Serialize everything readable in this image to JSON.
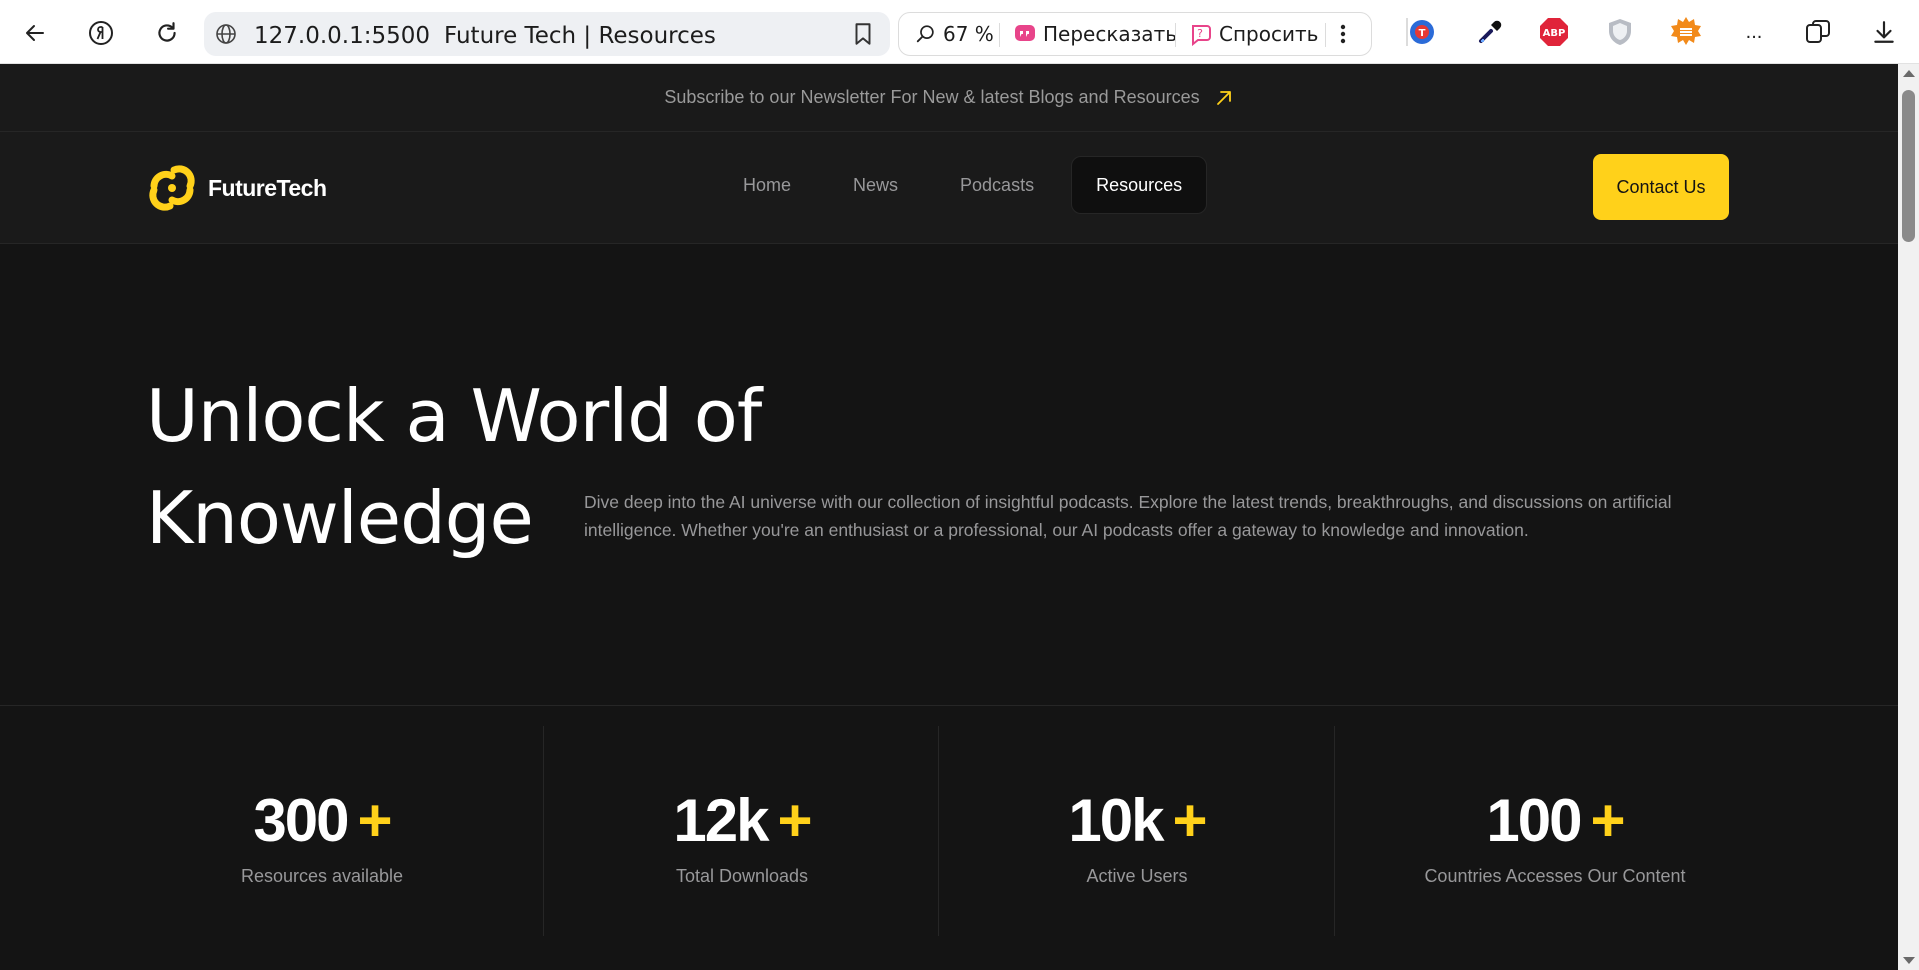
{
  "browser": {
    "url": "127.0.0.1:5500",
    "page_title": "Future Tech | Resources",
    "zoom": "67 %",
    "retell_label": "Пересказать",
    "ask_label": "Спросить",
    "more_label": "...",
    "abp_label": "ABP"
  },
  "newsletter": {
    "text": "Subscribe to our Newsletter For New & latest Blogs and Resources"
  },
  "header": {
    "logo_text": "FutureTech",
    "nav": [
      {
        "label": "Home"
      },
      {
        "label": "News"
      },
      {
        "label": "Podcasts"
      },
      {
        "label": "Resources"
      }
    ],
    "contact_label": "Contact Us"
  },
  "hero": {
    "title_line1": "Unlock a World of",
    "title_line2": "Knowledge",
    "description": "Dive deep into the AI universe with our collection of insightful podcasts. Explore the latest trends, breakthroughs, and discussions on artificial intelligence. Whether you're an enthusiast or a professional, our AI podcasts offer a gateway to knowledge and innovation."
  },
  "stats": [
    {
      "value": "300",
      "plus": "+",
      "label": "Resources available"
    },
    {
      "value": "12k",
      "plus": "+",
      "label": "Total Downloads"
    },
    {
      "value": "10k",
      "plus": "+",
      "label": "Active Users"
    },
    {
      "value": "100",
      "plus": "+",
      "label": "Countries Accesses Our Content"
    }
  ],
  "colors": {
    "accent": "#ffd11a",
    "background": "#141414",
    "panel": "#1a1a1a",
    "muted_text": "#98989a"
  }
}
